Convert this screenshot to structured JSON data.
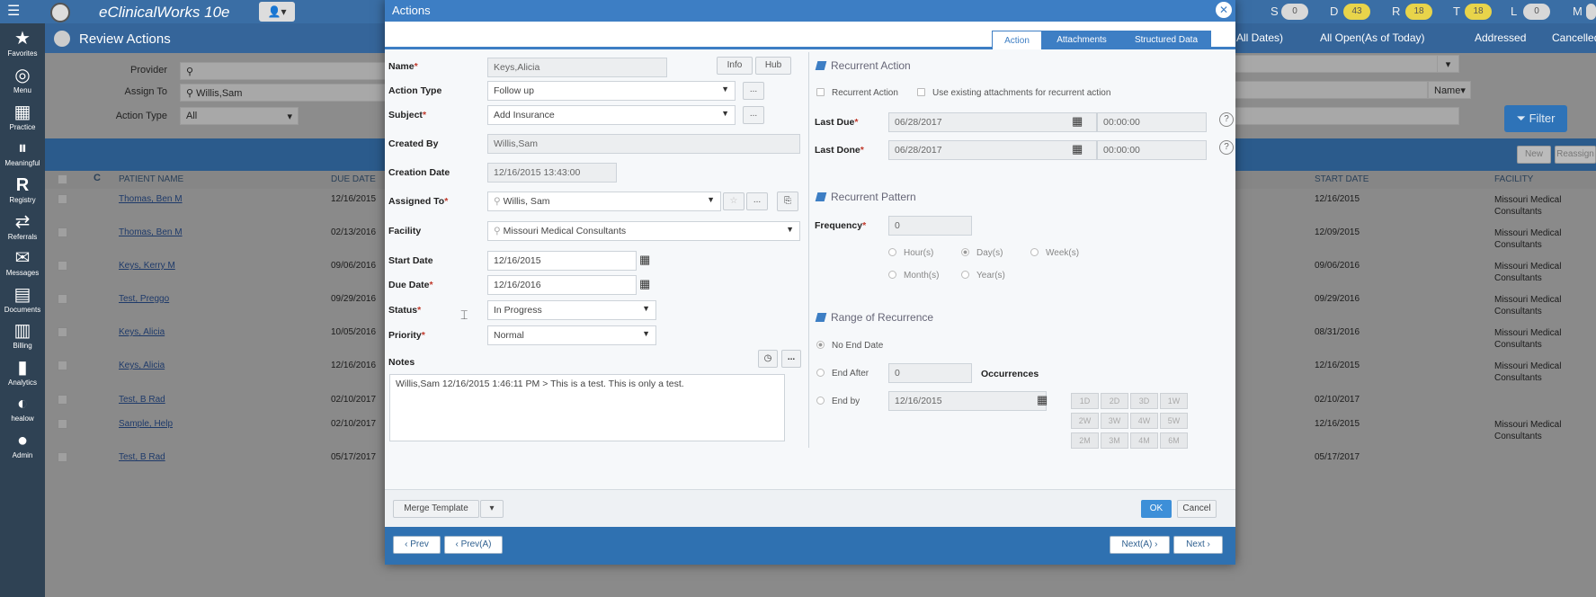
{
  "topbar": {
    "app_name": "eClinicalWorks 10e",
    "badges": [
      {
        "letter": "S",
        "count": "0",
        "color": "#d8d8d8"
      },
      {
        "letter": "D",
        "count": "43",
        "color": "#e8d44a"
      },
      {
        "letter": "R",
        "count": "18",
        "color": "#e8d44a"
      },
      {
        "letter": "T",
        "count": "18",
        "color": "#e8d44a"
      },
      {
        "letter": "L",
        "count": "0",
        "color": "#d8d8d8"
      },
      {
        "letter": "M",
        "count": "",
        "color": "#d8d8d8"
      }
    ]
  },
  "sidebar": {
    "items": [
      {
        "label": "Favorites",
        "icon": "star-icon"
      },
      {
        "label": "Menu",
        "icon": "menu-icon"
      },
      {
        "label": "Practice",
        "icon": "building-icon"
      },
      {
        "label": "Meaningful",
        "icon": "mu-icon"
      },
      {
        "label": "Registry",
        "icon": "registry-icon"
      },
      {
        "label": "Referrals",
        "icon": "arrows-icon"
      },
      {
        "label": "Messages",
        "icon": "envelope-icon"
      },
      {
        "label": "Documents",
        "icon": "document-icon"
      },
      {
        "label": "Billing",
        "icon": "billing-icon"
      },
      {
        "label": "Analytics",
        "icon": "chart-icon"
      },
      {
        "label": "healow",
        "icon": "healow-icon"
      },
      {
        "label": "Admin",
        "icon": "admin-icon"
      }
    ]
  },
  "review": {
    "title": "Review Actions",
    "tabs": [
      "All Dates)",
      "All Open(As of Today)",
      "Addressed",
      "Cancelled"
    ],
    "provider_label": "Provider",
    "assign_to_label": "Assign To",
    "assign_to_value": "Willis,Sam",
    "action_type_label": "Action Type",
    "action_type_value": "All",
    "name_select": "Name",
    "filter_button": "Filter",
    "new_button": "New",
    "reassign_button": "Reassign",
    "columns": {
      "patient": "PATIENT NAME",
      "due": "DUE DATE",
      "start": "START DATE",
      "facility": "FACILITY"
    },
    "rows": [
      {
        "patient": "Thomas, Ben M",
        "due": "12/16/2015",
        "start": "12/16/2015",
        "facility": "Missouri Medical Consultants"
      },
      {
        "patient": "Thomas, Ben M",
        "due": "02/13/2016",
        "start": "12/09/2015",
        "facility": "Missouri Medical Consultants"
      },
      {
        "patient": "Keys, Kerry M",
        "due": "09/06/2016",
        "start": "09/06/2016",
        "facility": "Missouri Medical Consultants"
      },
      {
        "patient": "Test, Preggo",
        "due": "09/29/2016",
        "start": "09/29/2016",
        "facility": "Missouri Medical Consultants"
      },
      {
        "patient": "Keys, Alicia",
        "due": "10/05/2016",
        "start": "08/31/2016",
        "facility": "Missouri Medical Consultants"
      },
      {
        "patient": "Keys, Alicia",
        "due": "12/16/2016",
        "start": "12/16/2015",
        "facility": "Missouri Medical Consultants"
      },
      {
        "patient": "Test, B Rad",
        "due": "02/10/2017",
        "start": "02/10/2017",
        "facility": ""
      },
      {
        "patient": "Sample, Help",
        "due": "02/10/2017",
        "start": "12/16/2015",
        "facility": "Missouri Medical Consultants"
      },
      {
        "patient": "Test, B Rad",
        "due": "05/17/2017",
        "start": "05/17/2017",
        "facility": ""
      }
    ]
  },
  "modal": {
    "title": "Actions",
    "tabs": [
      "Action",
      "Attachments",
      "Structured Data"
    ],
    "name_label": "Name",
    "name_value": "Keys,Alicia",
    "info_button": "Info",
    "hub_button": "Hub",
    "action_type_label": "Action Type",
    "action_type_value": "Follow up",
    "subject_label": "Subject",
    "subject_value": "Add Insurance",
    "created_by_label": "Created By",
    "created_by_value": "Willis,Sam",
    "creation_date_label": "Creation Date",
    "creation_date_value": "12/16/2015 13:43:00",
    "assigned_to_label": "Assigned To",
    "assigned_to_value": "Willis, Sam",
    "facility_label": "Facility",
    "facility_value": "Missouri Medical Consultants",
    "start_date_label": "Start Date",
    "start_date_value": "12/16/2015",
    "due_date_label": "Due Date",
    "due_date_value": "12/16/2016",
    "status_label": "Status",
    "status_value": "In Progress",
    "priority_label": "Priority",
    "priority_value": "Normal",
    "notes_label": "Notes",
    "notes_value": "Willis,Sam  12/16/2015 1:46:11 PM > This is a test.  This is only a test.",
    "ellipsis": "...",
    "recurrent": {
      "title": "Recurrent Action",
      "recurrent_checkbox": "Recurrent Action",
      "use_existing_checkbox": "Use existing attachments for recurrent action",
      "last_due_label": "Last Due",
      "last_due_date": "06/28/2017",
      "last_due_time": "00:00:00",
      "last_done_label": "Last Done",
      "last_done_date": "06/28/2017",
      "last_done_time": "00:00:00"
    },
    "pattern": {
      "title": "Recurrent Pattern",
      "frequency_label": "Frequency",
      "frequency_value": "0",
      "options": [
        "Hour(s)",
        "Day(s)",
        "Week(s)",
        "Month(s)",
        "Year(s)"
      ],
      "selected": "Day(s)"
    },
    "range": {
      "title": "Range of Recurrence",
      "no_end": "No End Date",
      "end_after": "End After",
      "end_after_value": "0",
      "occurrences": "Occurrences",
      "end_by": "End by",
      "end_by_value": "12/16/2015",
      "quick": [
        "1D",
        "2D",
        "3D",
        "1W",
        "2W",
        "3W",
        "4W",
        "5W",
        "2M",
        "3M",
        "4M",
        "6M"
      ]
    },
    "merge_template": "Merge Template",
    "ok": "OK",
    "cancel": "Cancel",
    "prev": "Prev",
    "prev_a": "Prev(A)",
    "next_a": "Next(A)",
    "next": "Next"
  }
}
